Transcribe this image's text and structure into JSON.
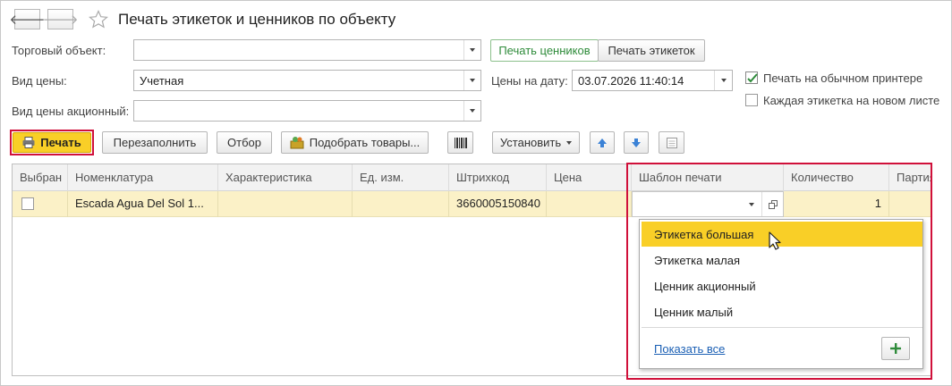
{
  "window": {
    "title": "Печать этикеток и ценников по объекту",
    "nav": {
      "back_icon": "arrow-left-icon",
      "forward_icon": "arrow-right-icon",
      "favorite_icon": "star-icon"
    }
  },
  "form": {
    "trade_object": {
      "label": "Торговый объект:",
      "value": ""
    },
    "price_type": {
      "label": "Вид цены:",
      "value": "Учетная"
    },
    "promo_price_type": {
      "label": "Вид цены акционный:",
      "value": ""
    },
    "price_date": {
      "label": "Цены на дату:",
      "value": "03.07.2026 11:40:14"
    },
    "mode_tabs": [
      "Печать ценников",
      "Печать этикеток"
    ],
    "print_regular_printer": {
      "label": "Печать на обычном принтере",
      "checked": true
    },
    "each_label_new_sheet": {
      "label": "Каждая этикетка на новом листе",
      "checked": false
    }
  },
  "toolbar": {
    "print_label": "Печать",
    "refill_label": "Перезаполнить",
    "filter_label": "Отбор",
    "pick_goods_label": "Подобрать товары...",
    "set_label": "Установить"
  },
  "table": {
    "columns": [
      "Выбран",
      "Номенклатура",
      "Характеристика",
      "Ед. изм.",
      "Штрихкод",
      "Цена",
      "Шаблон печати",
      "Количество",
      "Партия"
    ],
    "rows": [
      {
        "selected": false,
        "item": "Escada Agua Del Sol 1...",
        "characteristic": "",
        "unit": "",
        "barcode": "3660005150840",
        "price": "",
        "template": "",
        "quantity": "1",
        "batch": ""
      }
    ]
  },
  "template_dropdown": {
    "options": [
      "Этикетка большая",
      "Этикетка малая",
      "Ценник акционный",
      "Ценник малый"
    ],
    "highlighted_index": 0,
    "show_all_label": "Показать все",
    "add_icon": "plus-icon"
  },
  "colors": {
    "accent_green": "#2e8b3a",
    "highlight_yellow": "#f9cf27",
    "row_yellow": "#fbf1c7",
    "red_frame": "#d0103a",
    "link_blue": "#1a5fb4"
  }
}
